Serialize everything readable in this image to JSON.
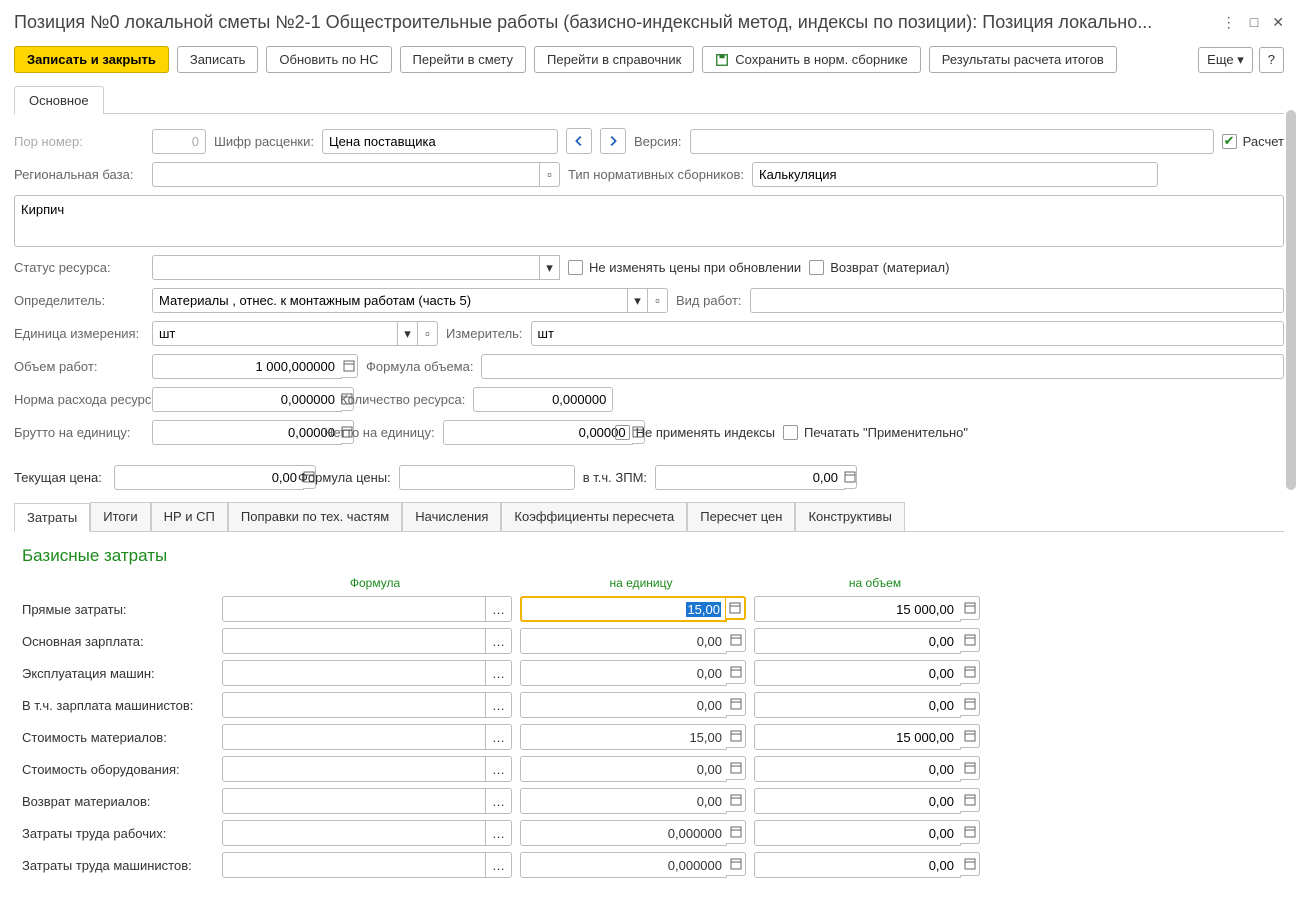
{
  "title": "Позиция №0 локальной сметы №2-1 Общестроительные работы (базисно-индексный метод, индексы по позиции): Позиция локально...",
  "toolbar": {
    "save_close": "Записать и закрыть",
    "save": "Записать",
    "update_ns": "Обновить по НС",
    "goto_estimate": "Перейти в смету",
    "goto_ref": "Перейти в справочник",
    "save_norm": "Сохранить в норм. сборнике",
    "results": "Результаты расчета итогов",
    "more": "Еще",
    "help": "?"
  },
  "main_tab": "Основное",
  "fields": {
    "por_number_label": "Пор номер:",
    "por_number_value": "0",
    "shifr_label": "Шифр расценки:",
    "shifr_value": "Цена поставщика",
    "version_label": "Версия:",
    "version_value": "",
    "calc_checkbox": "Расчет",
    "reg_base_label": "Региональная база:",
    "reg_base_value": "",
    "norm_type_label": "Тип нормативных сборников:",
    "norm_type_value": "Калькуляция",
    "description": "Кирпич",
    "status_label": "Статус ресурса:",
    "status_value": "",
    "no_change_prices": "Не изменять цены при обновлении",
    "return_material": "Возврат (материал)",
    "determ_label": "Определитель:",
    "determ_value": "Материалы , отнес. к монтажным работам (часть 5)",
    "work_type_label": "Вид работ:",
    "work_type_value": "",
    "unit_label": "Единица измерения:",
    "unit_value": "шт",
    "measure_label": "Измеритель:",
    "measure_value": "шт",
    "volume_label": "Объем работ:",
    "volume_value": "1 000,000000",
    "volume_formula_label": "Формула объема:",
    "norm_rate_label": "Норма расхода ресурса:",
    "norm_rate_value": "0,000000",
    "qty_label": "Количество ресурса:",
    "qty_value": "0,000000",
    "brutto_label": "Брутто на единицу:",
    "brutto_value": "0,00000",
    "netto_label": "Нетто на единицу:",
    "netto_value": "0,00000",
    "no_index": "Не применять индексы",
    "print_approx": "Печатать \"Применительно\"",
    "current_price_label": "Текущая цена:",
    "current_price_value": "0,00",
    "price_formula_label": "Формула цены:",
    "incl_zpm_label": "в т.ч. ЗПМ:",
    "incl_zpm_value": "0,00"
  },
  "sub_tabs": [
    "Затраты",
    "Итоги",
    "НР и СП",
    "Поправки по тех. частям",
    "Начисления",
    "Коэффициенты пересчета",
    "Пересчет цен",
    "Конструктивы"
  ],
  "costs": {
    "title": "Базисные затраты",
    "headers": {
      "formula": "Формула",
      "unit": "на единицу",
      "volume": "на объем"
    },
    "rows": [
      {
        "label": "Прямые затраты:",
        "formula": "",
        "unit": "15,00",
        "volume": "15 000,00",
        "active": true
      },
      {
        "label": "Основная зарплата:",
        "formula": "",
        "unit": "0,00",
        "volume": "0,00"
      },
      {
        "label": "Эксплуатация машин:",
        "formula": "",
        "unit": "0,00",
        "volume": "0,00"
      },
      {
        "label": "В т.ч. зарплата машинистов:",
        "formula": "",
        "unit": "0,00",
        "volume": "0,00"
      },
      {
        "label": "Стоимость материалов:",
        "formula": "",
        "unit": "15,00",
        "volume": "15 000,00"
      },
      {
        "label": "Стоимость оборудования:",
        "formula": "",
        "unit": "0,00",
        "volume": "0,00"
      },
      {
        "label": "Возврат материалов:",
        "formula": "",
        "unit": "0,00",
        "volume": "0,00"
      },
      {
        "label": "Затраты труда рабочих:",
        "formula": "",
        "unit": "0,000000",
        "volume": "0,00"
      },
      {
        "label": "Затраты труда машинистов:",
        "formula": "",
        "unit": "0,000000",
        "volume": "0,00"
      }
    ]
  }
}
